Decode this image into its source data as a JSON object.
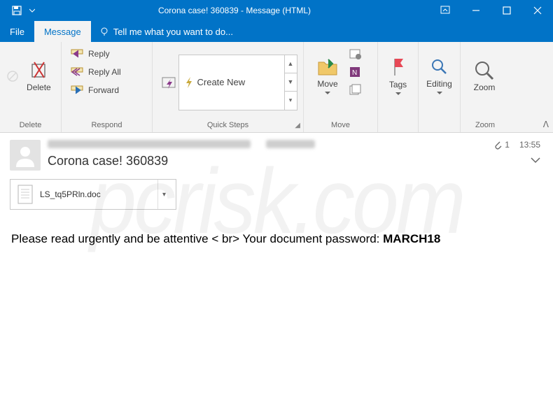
{
  "titlebar": {
    "title": "Corona case! 360839 - Message (HTML)"
  },
  "tabs": {
    "file": "File",
    "message": "Message",
    "tellme": "Tell me what you want to do..."
  },
  "ribbon": {
    "delete": {
      "label": "Delete",
      "big": "Delete"
    },
    "respond": {
      "label": "Respond",
      "reply": "Reply",
      "replyall": "Reply All",
      "forward": "Forward"
    },
    "quicksteps": {
      "label": "Quick Steps",
      "create": "Create New"
    },
    "move": {
      "label": "Move",
      "big": "Move"
    },
    "tags": {
      "label": "Tags"
    },
    "editing": {
      "label": "Editing"
    },
    "zoom": {
      "label": "Zoom",
      "big": "Zoom"
    }
  },
  "header": {
    "subject": "Corona case! 360839",
    "attcount": "1",
    "time": "13:55"
  },
  "attachment": {
    "name": "LS_tq5PRln.doc"
  },
  "body": {
    "prefix": "Please read urgently and be attentive < br> Your document password: ",
    "password": "MARCH18"
  },
  "watermark": "pcrisk.com"
}
